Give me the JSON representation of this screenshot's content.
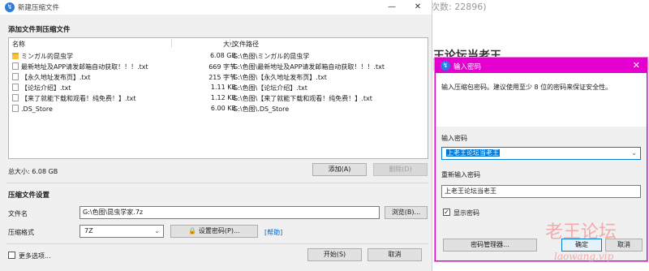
{
  "background": {
    "count_text": "浏次数: 22896)",
    "heading_text": "王论坛当老王"
  },
  "main_window": {
    "title": "新建压缩文件",
    "minimize_glyph": "—",
    "close_glyph": "✕",
    "section_add_title": "添加文件到压缩文件",
    "columns": {
      "name": "名称",
      "size": "大小",
      "path": "文件路径"
    },
    "files": [
      {
        "icon": "folder-icon",
        "name": "ミンガル的昆虫学",
        "size": "6.08 GB",
        "path": "G:\\色图\\ミンガル的昆虫学"
      },
      {
        "icon": "document-icon",
        "name": "最新地址及APP请发邮箱自动获取！！！.txt",
        "size": "669 字节",
        "path": "G:\\色图\\最新地址及APP请发邮箱自动获取！！！.txt"
      },
      {
        "icon": "document-icon",
        "name": "【永久地址发布页】.txt",
        "size": "215 字节",
        "path": "G:\\色图\\【永久地址发布页】.txt"
      },
      {
        "icon": "document-icon",
        "name": "【论坛介绍】.txt",
        "size": "1.11 KB",
        "path": "G:\\色图\\【论坛介绍】.txt"
      },
      {
        "icon": "document-icon",
        "name": "【来了就能下载和观看！纯免费！】.txt",
        "size": "1.12 KB",
        "path": "G:\\色图\\【来了就能下载和观看！纯免费！】.txt"
      },
      {
        "icon": "document-icon",
        "name": ".DS_Store",
        "size": "6.00 KB",
        "path": "G:\\色图\\.DS_Store"
      }
    ],
    "total_size": "总大小: 6.08 GB",
    "add_button": "添加(A)",
    "delete_button": "删除(D)",
    "section_settings_title": "压缩文件设置",
    "filename_label": "文件名",
    "filename_value": "G:\\色图\\昆虫学家.7z",
    "browse_button": "浏览(B)...",
    "format_label": "压缩格式",
    "format_value": "7Z",
    "set_password_button": "设置密码(P)...",
    "help_link": "[帮助]",
    "more_options_label": "更多选项...",
    "start_button": "开始(S)",
    "cancel_button": "取消"
  },
  "password_dialog": {
    "title": "输入密码",
    "close_glyph": "✕",
    "description": "输入压缩包密码。建议使用至少 8 位的密码来保证安全性。",
    "enter_label": "输入密码",
    "enter_value": "上老王论坛当老王",
    "reenter_label": "重新输入密码",
    "reenter_value": "上老王论坛当老王",
    "show_password_label": "显示密码",
    "show_password_checked": true,
    "password_manager_button": "密码管理器...",
    "ok_button": "确定",
    "cancel_button": "取消"
  },
  "watermark": {
    "line1": "老王论坛",
    "line2": "laowang.vip"
  }
}
